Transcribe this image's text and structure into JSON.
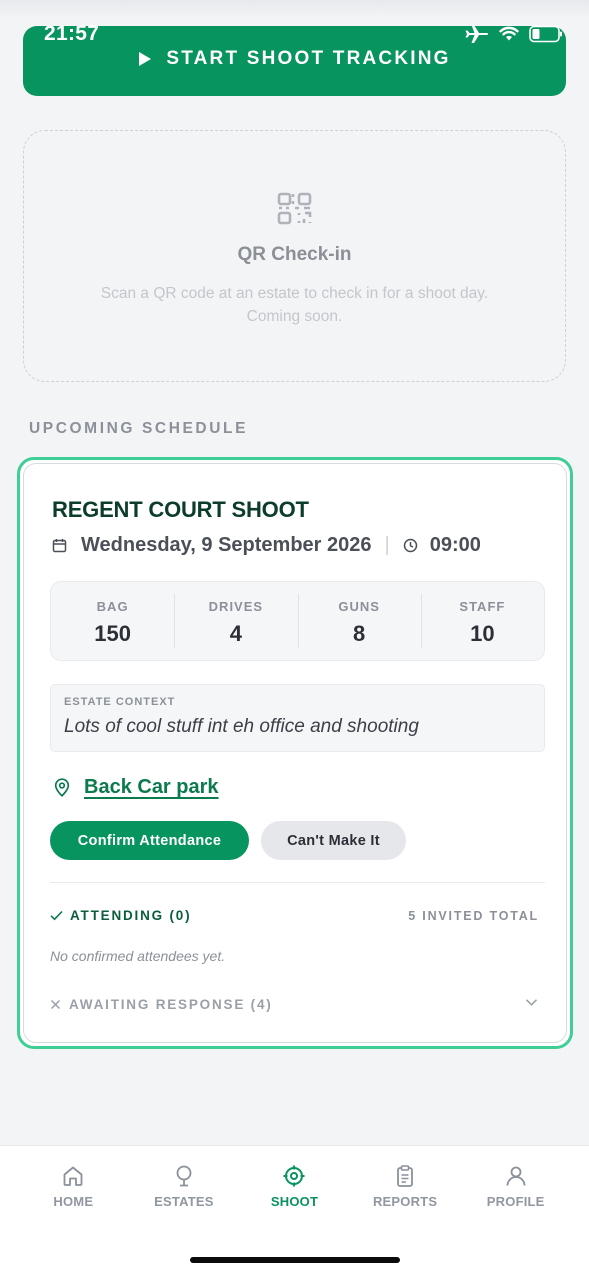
{
  "status_bar": {
    "time": "21:57"
  },
  "start_button": {
    "label": "START SHOOT TRACKING"
  },
  "qr_card": {
    "title": "QR Check-in",
    "description": "Scan a QR code at an estate to check in for a shoot day. Coming soon."
  },
  "section_label": "UPCOMING SCHEDULE",
  "shoot": {
    "title": "REGENT COURT SHOOT",
    "date": "Wednesday, 9 September 2026",
    "separator": "|",
    "time": "09:00",
    "stats": [
      {
        "label": "BAG",
        "value": "150"
      },
      {
        "label": "DRIVES",
        "value": "4"
      },
      {
        "label": "GUNS",
        "value": "8"
      },
      {
        "label": "STAFF",
        "value": "10"
      }
    ],
    "context_label": "ESTATE CONTEXT",
    "context_text": "Lots of cool stuff int eh office and shooting",
    "location": "Back Car park",
    "confirm_label": "Confirm Attendance",
    "cant_label": "Can't Make It",
    "attending_label": "ATTENDING (0)",
    "invited_label": "5 INVITED TOTAL",
    "empty_note": "No confirmed attendees yet.",
    "awaiting_label": "AWAITING RESPONSE (4)"
  },
  "nav": {
    "items": [
      {
        "label": "HOME",
        "icon": "home-icon"
      },
      {
        "label": "ESTATES",
        "icon": "tree-icon"
      },
      {
        "label": "SHOOT",
        "icon": "crosshair-icon",
        "active": true
      },
      {
        "label": "REPORTS",
        "icon": "clipboard-icon"
      },
      {
        "label": "PROFILE",
        "icon": "user-icon"
      }
    ]
  },
  "colors": {
    "brand": "#08945f",
    "accent_border": "#3fce95",
    "title": "#0b3d2a"
  }
}
